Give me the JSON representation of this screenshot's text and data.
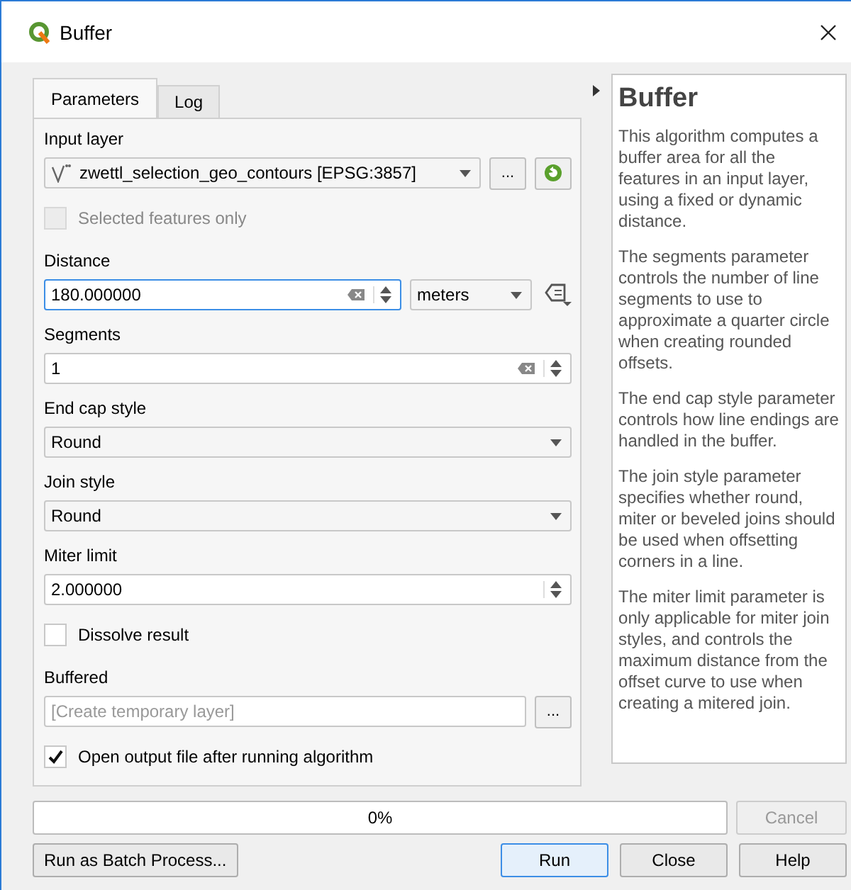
{
  "window": {
    "title": "Buffer"
  },
  "tabs": [
    {
      "label": "Parameters",
      "selected": true
    },
    {
      "label": "Log",
      "selected": false
    }
  ],
  "parameters": [
    {
      "kind": "layer",
      "label": "Input layer",
      "value": "zwettl_selection_geo_contours [EPSG:3857]",
      "button": "..."
    },
    {
      "kind": "checkbox",
      "label": "Selected features only",
      "checked": false,
      "disabled": true
    },
    {
      "kind": "number",
      "label": "Distance",
      "value": "180.000000",
      "clearable": true,
      "focused": true,
      "unit": "meters"
    },
    {
      "kind": "number",
      "label": "Segments",
      "value": "1",
      "clearable": true,
      "focused": false
    },
    {
      "kind": "combo",
      "label": "End cap style",
      "value": "Round"
    },
    {
      "kind": "combo",
      "label": "Join style",
      "value": "Round"
    },
    {
      "kind": "number",
      "label": "Miter limit",
      "value": "2.000000",
      "clearable": false,
      "focused": false
    },
    {
      "kind": "checkbox",
      "label": "Dissolve result",
      "checked": false,
      "disabled": false
    },
    {
      "kind": "file",
      "label": "Buffered",
      "placeholder": "[Create temporary layer]",
      "button": "..."
    },
    {
      "kind": "checkbox",
      "label": "Open output file after running algorithm",
      "checked": true,
      "disabled": false
    }
  ],
  "help": {
    "title": "Buffer",
    "paragraphs": [
      "This algorithm computes a buffer area for all the features in an input layer, using a fixed or dynamic distance.",
      "The segments parameter controls the number of line segments to use to approximate a quarter circle when creating rounded offsets.",
      "The end cap style parameter controls how line endings are handled in the buffer.",
      "The join style parameter specifies whether round, miter or beveled joins should be used when offsetting corners in a line.",
      "The miter limit parameter is only applicable for miter join styles, and controls the maximum distance from the offset curve to use when creating a mitered join."
    ]
  },
  "progress": {
    "level": 0,
    "reading": "0%"
  },
  "cancel": {
    "label": "Cancel",
    "disabled": true
  },
  "buttons": [
    {
      "label": "Run as Batch Process...",
      "kind": "left",
      "default": false
    },
    {
      "label": "Run",
      "kind": "right",
      "default": true
    },
    {
      "label": "Close",
      "kind": "right",
      "default": false
    },
    {
      "label": "Help",
      "kind": "right",
      "default": false
    }
  ]
}
